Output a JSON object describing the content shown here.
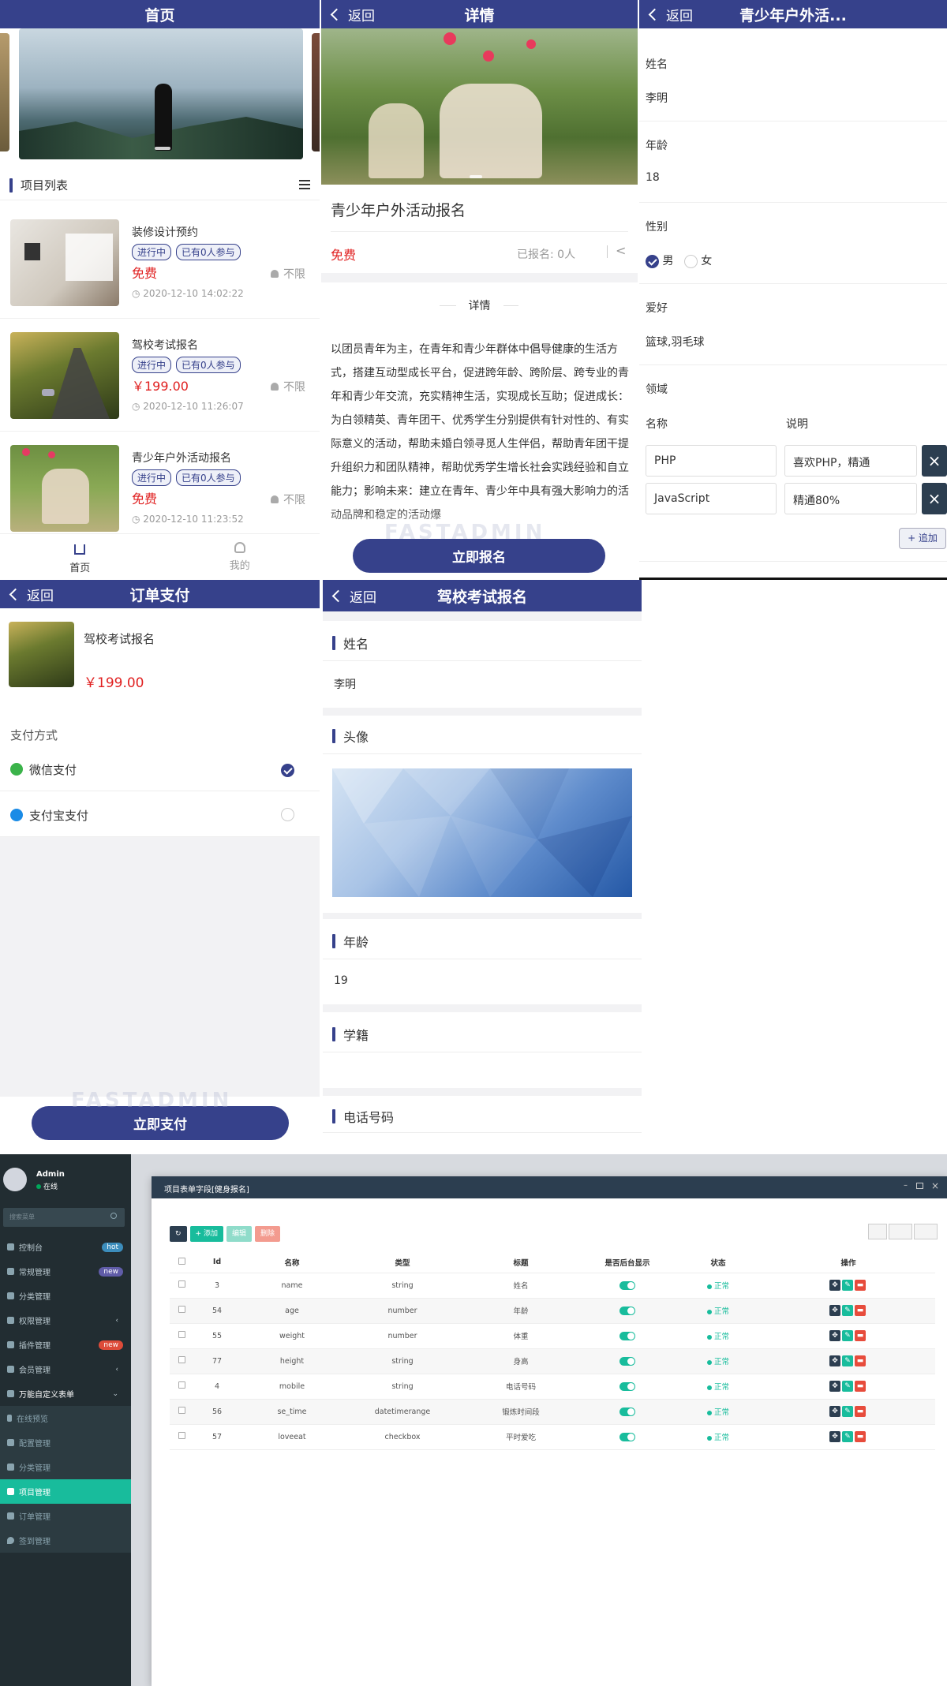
{
  "home": {
    "title": "首页",
    "list_title": "项目列表",
    "items": [
      {
        "title": "装修设计预约",
        "tags": [
          "进行中",
          "已有0人参与"
        ],
        "price": "免费",
        "limit": "不限",
        "time": "2020-12-10 14:02:22"
      },
      {
        "title": "驾校考试报名",
        "tags": [
          "进行中",
          "已有0人参与"
        ],
        "price": "￥199.00",
        "limit": "不限",
        "time": "2020-12-10 11:26:07"
      },
      {
        "title": "青少年户外活动报名",
        "tags": [
          "进行中",
          "已有0人参与"
        ],
        "price": "免费",
        "limit": "不限",
        "time": "2020-12-10 11:23:52"
      }
    ],
    "tabbar": {
      "home": "首页",
      "mine": "我的"
    }
  },
  "detail": {
    "back": "返回",
    "title": "详情",
    "name": "青少年户外活动报名",
    "price": "免费",
    "signed": "已报名: 0人",
    "section": "详情",
    "body": "以团员青年为主，在青年和青少年群体中倡导健康的生活方式，搭建互动型成长平台，促进跨年龄、跨阶层、跨专业的青年和青少年交流，充实精神生活，实现成长互助；促进成长：为白领精英、青年团干、优秀学生分别提供有针对性的、有实际意义的活动，帮助未婚白领寻觅人生伴侣，帮助青年团干提升组织力和团队精神，帮助优秀学生增长社会实践经验和自立能力；影响未来：建立在青年、青少年中具有强大影响力的活动品牌和稳定的活动爆",
    "button": "立即报名",
    "watermark": "FASTADMIN"
  },
  "form": {
    "back": "返回",
    "title": "青少年户外活...",
    "name_label": "姓名",
    "name": "李明",
    "age_label": "年龄",
    "age": "18",
    "gender_label": "性别",
    "male": "男",
    "female": "女",
    "hobby_label": "爱好",
    "hobby": "篮球,羽毛球",
    "field_label": "领域",
    "col_name": "名称",
    "col_desc": "说明",
    "rows": [
      {
        "name": "PHP",
        "desc": "喜欢PHP，精通"
      },
      {
        "name": "JavaScript",
        "desc": "精通80%"
      }
    ],
    "add": "+ 追加"
  },
  "pay": {
    "back": "返回",
    "title": "订单支付",
    "item": "驾校考试报名",
    "price": "￥199.00",
    "method_label": "支付方式",
    "wechat": "微信支付",
    "alipay": "支付宝支付",
    "button": "立即支付",
    "watermark": "FASTADMIN"
  },
  "signup": {
    "back": "返回",
    "title": "驾校考试报名",
    "name_label": "姓名",
    "name": "李明",
    "avatar_label": "头像",
    "age_label": "年龄",
    "age": "19",
    "school_label": "学籍",
    "phone_label": "电话号码"
  },
  "admin": {
    "user": "Admin",
    "status": "在线",
    "search_placeholder": "搜索菜单",
    "menu": [
      {
        "label": "控制台",
        "badge": "hot",
        "color": "#3c8dbc"
      },
      {
        "label": "常规管理",
        "badge": "new",
        "color": "#605ca8"
      },
      {
        "label": "分类管理",
        "badge": "",
        "color": ""
      },
      {
        "label": "权限管理",
        "badge": "‹",
        "color": ""
      },
      {
        "label": "插件管理",
        "badge": "new",
        "color": "#dd4b39"
      },
      {
        "label": "会员管理",
        "badge": "‹",
        "color": ""
      },
      {
        "label": "万能自定义表单",
        "badge": "⌄",
        "color": ""
      }
    ],
    "submenu": [
      "在线预览",
      "配置管理",
      "分类管理",
      "项目管理",
      "订单管理",
      "签到管理"
    ],
    "window_title": "项目表单字段[健身报名]",
    "toolbar": {
      "add": "+ 添加",
      "edit": "编辑",
      "del": "删除"
    },
    "columns": [
      "Id",
      "名称",
      "类型",
      "标题",
      "是否后台显示",
      "状态",
      "操作"
    ],
    "rows": [
      {
        "id": "3",
        "name": "name",
        "type": "string",
        "title": "姓名",
        "status": "正常"
      },
      {
        "id": "54",
        "name": "age",
        "type": "number",
        "title": "年龄",
        "status": "正常"
      },
      {
        "id": "55",
        "name": "weight",
        "type": "number",
        "title": "体重",
        "status": "正常"
      },
      {
        "id": "77",
        "name": "height",
        "type": "string",
        "title": "身高",
        "status": "正常"
      },
      {
        "id": "4",
        "name": "mobile",
        "type": "string",
        "title": "电话号码",
        "status": "正常"
      },
      {
        "id": "56",
        "name": "se_time",
        "type": "datetimerange",
        "title": "锻炼时间段",
        "status": "正常"
      },
      {
        "id": "57",
        "name": "loveeat",
        "type": "checkbox",
        "title": "平时爱吃",
        "status": "正常"
      }
    ]
  }
}
